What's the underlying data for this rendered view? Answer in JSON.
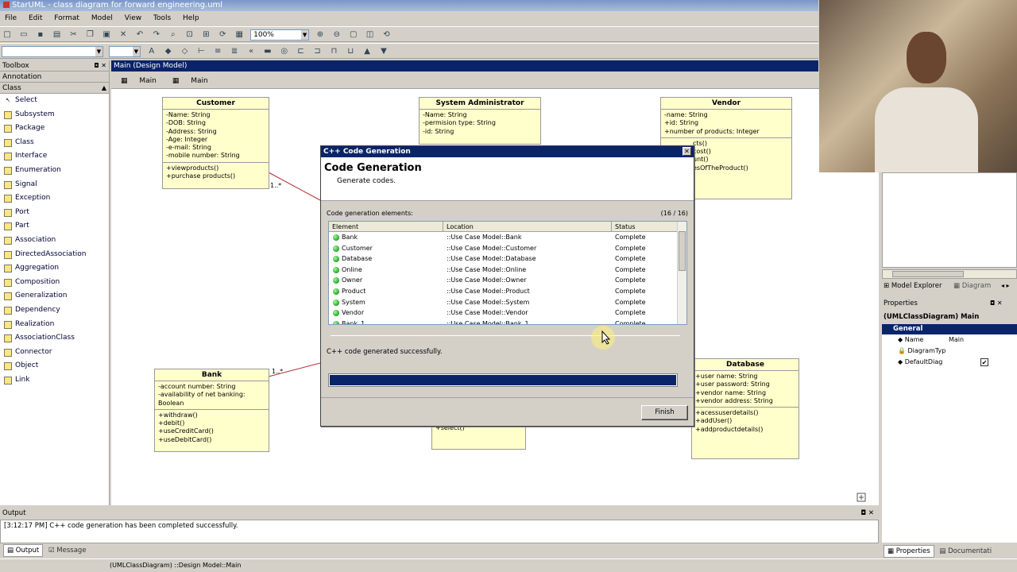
{
  "window": {
    "title": "StarUML - class diagram for forward engineering.uml"
  },
  "menu": [
    "File",
    "Edit",
    "Format",
    "Model",
    "View",
    "Tools",
    "Help"
  ],
  "toolbar": {
    "zoom": "100%"
  },
  "toolbox": {
    "title": "Toolbox",
    "sections": [
      "Annotation",
      "Class"
    ],
    "items": [
      "Select",
      "Subsystem",
      "Package",
      "Class",
      "Interface",
      "Enumeration",
      "Signal",
      "Exception",
      "Port",
      "Part",
      "Association",
      "DirectedAssociation",
      "Aggregation",
      "Composition",
      "Generalization",
      "Dependency",
      "Realization",
      "AssociationClass",
      "Connector",
      "Object",
      "Link"
    ]
  },
  "diagram": {
    "title": "Main (Design Model)",
    "tabs": [
      "Main",
      "Main"
    ],
    "classes": {
      "customer": {
        "name": "Customer",
        "attrs": [
          "-Name: String",
          "-DOB: String",
          "-Address: String",
          "-Age: Integer",
          "-e-mail: String",
          "-mobile number: String"
        ],
        "ops": [
          "+viewproducts()",
          "+purchase products()"
        ]
      },
      "sysadmin": {
        "name": "System Administrator",
        "attrs": [
          "-Name: String",
          "-permision type: String",
          "-id: String"
        ]
      },
      "vendor": {
        "name": "Vendor",
        "attrs": [
          "-name: String",
          "+id: String",
          "+number of products: Integer"
        ],
        "ops": [
          "cts()",
          "cost()",
          "unt()",
          "esOfTheProduct()"
        ]
      },
      "bank": {
        "name": "Bank",
        "attrs": [
          "-account number: String",
          "-availability of net banking: Boolean"
        ],
        "ops": [
          "+withdraw()",
          "+debit()",
          "+useCreditCard()",
          "+useDebitCard()"
        ]
      },
      "database": {
        "name": "Database",
        "attrs": [
          "+user name: String",
          "+user password: String",
          "+vendor name: String",
          "+vendor address: String"
        ],
        "ops": [
          "+acessuserdetails()",
          "+addUser()",
          "+addproductdetails()"
        ]
      },
      "hidden": {
        "ops": [
          "+select()"
        ]
      }
    },
    "multiplicity1": "1..*",
    "multiplicity2": "1..*"
  },
  "dialog": {
    "title": "C++ Code Generation",
    "heading": "Code Generation",
    "subheading": "Generate codes.",
    "elements_label": "Code generation elements:",
    "count": "(16 / 16)",
    "columns": [
      "Element",
      "Location",
      "Status"
    ],
    "rows": [
      {
        "el": "Bank",
        "loc": "::Use Case Model::Bank",
        "st": "Complete"
      },
      {
        "el": "Customer",
        "loc": "::Use Case Model::Customer",
        "st": "Complete"
      },
      {
        "el": "Database",
        "loc": "::Use Case Model::Database",
        "st": "Complete"
      },
      {
        "el": "Online",
        "loc": "::Use Case Model::Online",
        "st": "Complete"
      },
      {
        "el": "Owner",
        "loc": "::Use Case Model::Owner",
        "st": "Complete"
      },
      {
        "el": "Product",
        "loc": "::Use Case Model::Product",
        "st": "Complete"
      },
      {
        "el": "System",
        "loc": "::Use Case Model::System",
        "st": "Complete"
      },
      {
        "el": "Vendor",
        "loc": "::Use Case Model::Vendor",
        "st": "Complete"
      },
      {
        "el": "Bank_1",
        "loc": "::Use Case Model::Bank_1",
        "st": "Complete"
      }
    ],
    "message": "C++ code generated successfully.",
    "progress": 1.0,
    "finish": "Finish"
  },
  "right": {
    "tabs": [
      "Model Explorer",
      "Diagram"
    ],
    "properties_title": "Properties",
    "selection": "(UMLClassDiagram) Main",
    "group": "General",
    "props": [
      {
        "k": "Name",
        "v": "Main"
      },
      {
        "k": "DiagramTyp",
        "v": ""
      },
      {
        "k": "DefaultDiag",
        "v": "✔"
      }
    ],
    "bottom_tabs": [
      "Properties",
      "Documentati"
    ]
  },
  "output": {
    "title": "Output",
    "line": "[3:12:17 PM]  C++ code generation has been completed successfully.",
    "tabs": [
      "Output",
      "Message"
    ]
  },
  "status": "(UMLClassDiagram) ::Design Model::Main"
}
